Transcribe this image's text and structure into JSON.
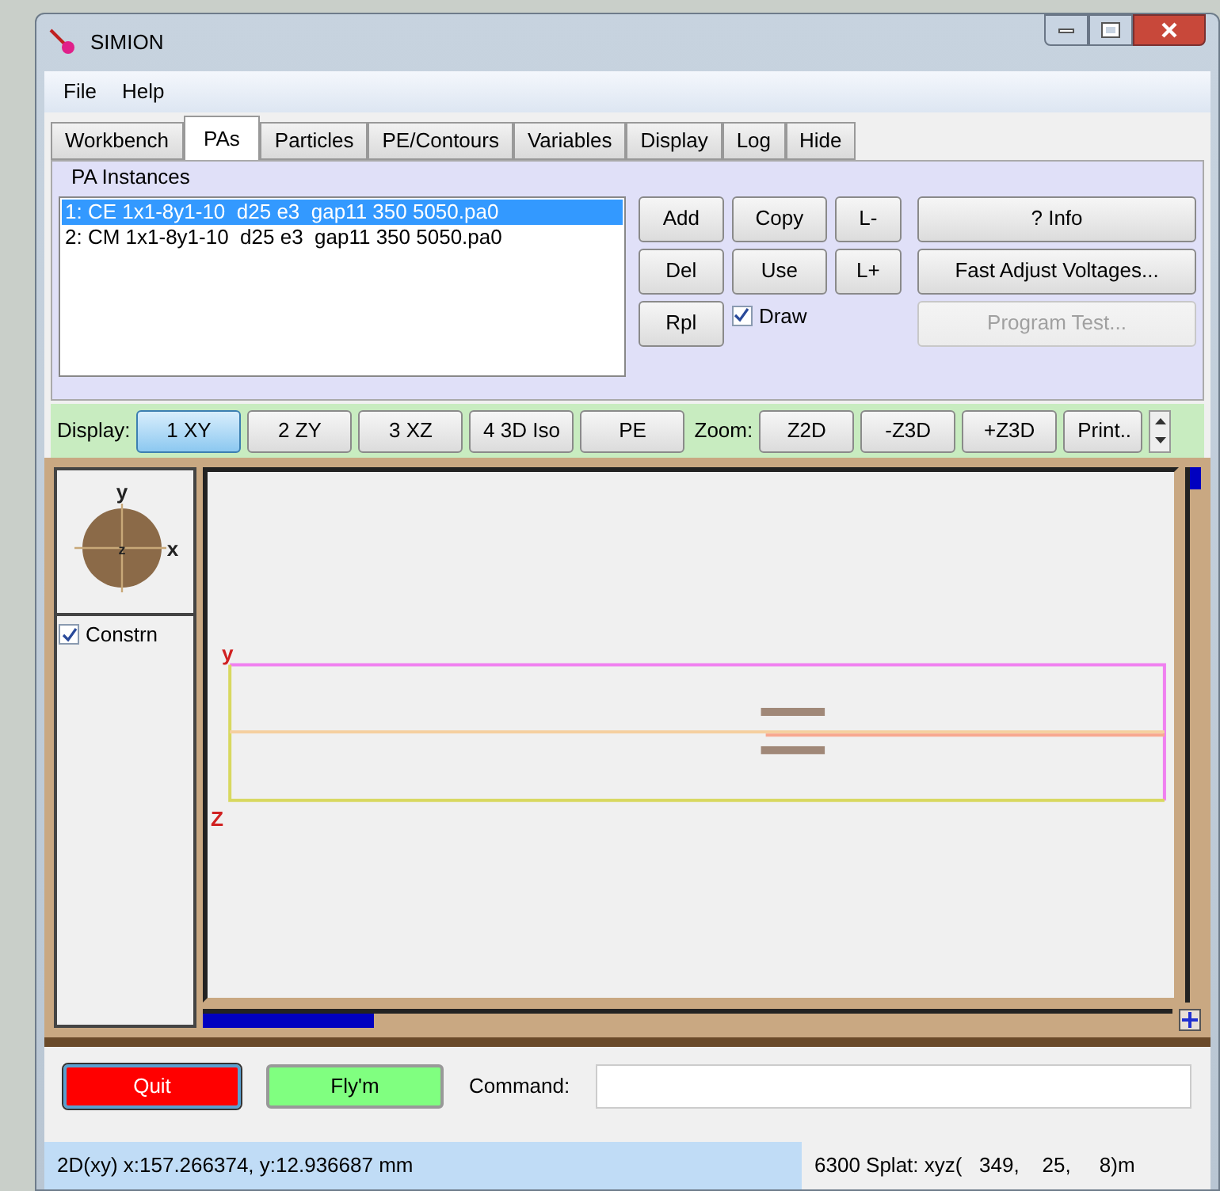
{
  "window": {
    "title": "SIMION"
  },
  "menu": [
    "File",
    "Help"
  ],
  "tabs": [
    {
      "label": "Workbench",
      "selected": false
    },
    {
      "label": "PAs",
      "selected": true
    },
    {
      "label": "Particles",
      "selected": false
    },
    {
      "label": "PE/Contours",
      "selected": false
    },
    {
      "label": "Variables",
      "selected": false
    },
    {
      "label": "Display",
      "selected": false
    },
    {
      "label": "Log",
      "selected": false
    },
    {
      "label": "Hide",
      "selected": false
    }
  ],
  "pa_panel": {
    "title": "PA Instances",
    "instances": [
      {
        "label": "1: CE 1x1-8y1-10  d25 e3  gap11 350 5050.pa0",
        "selected": true
      },
      {
        "label": "2: CM 1x1-8y1-10  d25 e3  gap11 350 5050.pa0",
        "selected": false
      }
    ],
    "buttons": [
      "Add",
      "Copy",
      "L-",
      "Del",
      "Use",
      "L+",
      "Rpl"
    ],
    "draw": {
      "label": "Draw",
      "checked": true
    },
    "actions": [
      {
        "label": "? Info",
        "disabled": false
      },
      {
        "label": "Fast Adjust Voltages...",
        "disabled": false
      },
      {
        "label": "Program Test...",
        "disabled": true
      }
    ]
  },
  "display_bar": {
    "label": "Display:",
    "views": [
      {
        "label": "1 XY",
        "selected": true
      },
      {
        "label": "2 ZY",
        "selected": false
      },
      {
        "label": "3 XZ",
        "selected": false
      },
      {
        "label": "4 3D Iso",
        "selected": false
      },
      {
        "label": "PE",
        "selected": false
      }
    ],
    "zoom_label": "Zoom:",
    "zoom": [
      "Z2D",
      "-Z3D",
      "+Z3D"
    ],
    "print": "Print.."
  },
  "view": {
    "orientation": {
      "up": "y",
      "right": "x",
      "center": "z"
    },
    "constrain": {
      "label": "Constrn",
      "checked": true
    },
    "axis_top": "y",
    "axis_bottom": "Z"
  },
  "bottom": {
    "quit": "Quit",
    "flym": "Fly'm",
    "command_label": "Command:"
  },
  "status_bar": [
    "2D(xy) x:157.266374, y:12.936687 mm",
    "6300 Splat: xyz(   349,    25,     8)m"
  ]
}
